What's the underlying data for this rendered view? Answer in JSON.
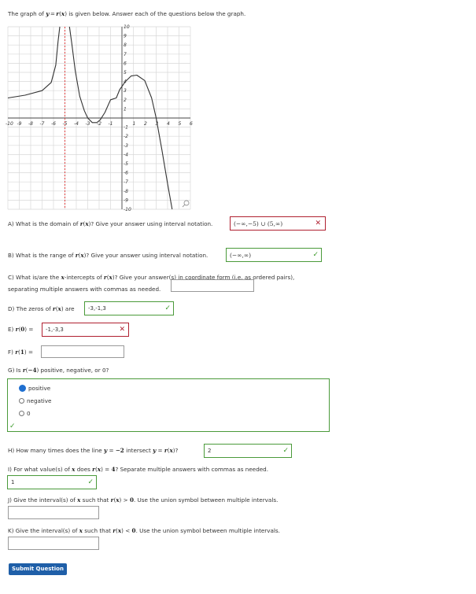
{
  "intro": "The graph of y = r(x) is given below. Answer each of the questions below the graph.",
  "graph": {
    "x_ticks": [
      "-10",
      "-9",
      "-8",
      "-7",
      "-6",
      "-5",
      "-4",
      "-3",
      "-2",
      "-1",
      "1",
      "2",
      "3",
      "4",
      "5",
      "6"
    ],
    "y_ticks": [
      "10",
      "9",
      "8",
      "7",
      "6",
      "5",
      "4",
      "3",
      "2",
      "1",
      "-1",
      "-2",
      "-3",
      "-4",
      "-5",
      "-6",
      "-7",
      "-8",
      "-9",
      "-10"
    ],
    "xlim": [
      -10,
      6
    ],
    "ylim": [
      -10,
      10
    ],
    "curve_color": "#333333",
    "asymptote_color": "#e04040",
    "asymptote_x": -5,
    "zoom_icon": "magnifier-icon"
  },
  "qA": {
    "label": "A) What is the domain of r(x)? Give your answer using interval notation.",
    "answer": "(−∞,−5) ∪ (5,∞)",
    "status": "incorrect"
  },
  "qB": {
    "label": "B) What is the range of r(x)? Give your answer using interval notation.",
    "answer": "(−∞,∞)",
    "status": "correct"
  },
  "qC": {
    "line1": "C) What is/are the x-intercepts of r(x)? Give your answer(s) in coordinate form (i.e. as ordered pairs),",
    "line2": "separating multiple answers with commas as needed.",
    "answer": ""
  },
  "qD": {
    "label": "D) The zeros of r(x) are",
    "answer": "-3,-1,3",
    "status": "correct"
  },
  "qE": {
    "label": "E) r(0) =",
    "answer": "-1,-3,3",
    "status": "incorrect"
  },
  "qF": {
    "label": "F) r(1) =",
    "answer": ""
  },
  "qG": {
    "label": "G) Is r(−4) positive, negative, or 0?",
    "options": [
      "positive",
      "negative",
      "0"
    ],
    "selected": "positive",
    "status": "correct"
  },
  "qH": {
    "label": "H) How many times does the line y = −2 intersect y = r(x)?",
    "answer": "2",
    "status": "correct"
  },
  "qI": {
    "label": "I) For what value(s) of x does r(x) = 4? Separate multiple answers with commas as needed.",
    "answer": "1",
    "status": "correct"
  },
  "qJ": {
    "label": "J) Give the interval(s) of x such that r(x) > 0. Use the union symbol between multiple intervals.",
    "answer": ""
  },
  "qK": {
    "label": "K) Give the interval(s) of x such that r(x) < 0. Use the union symbol between multiple intervals.",
    "answer": ""
  },
  "submit_label": "Submit Question"
}
